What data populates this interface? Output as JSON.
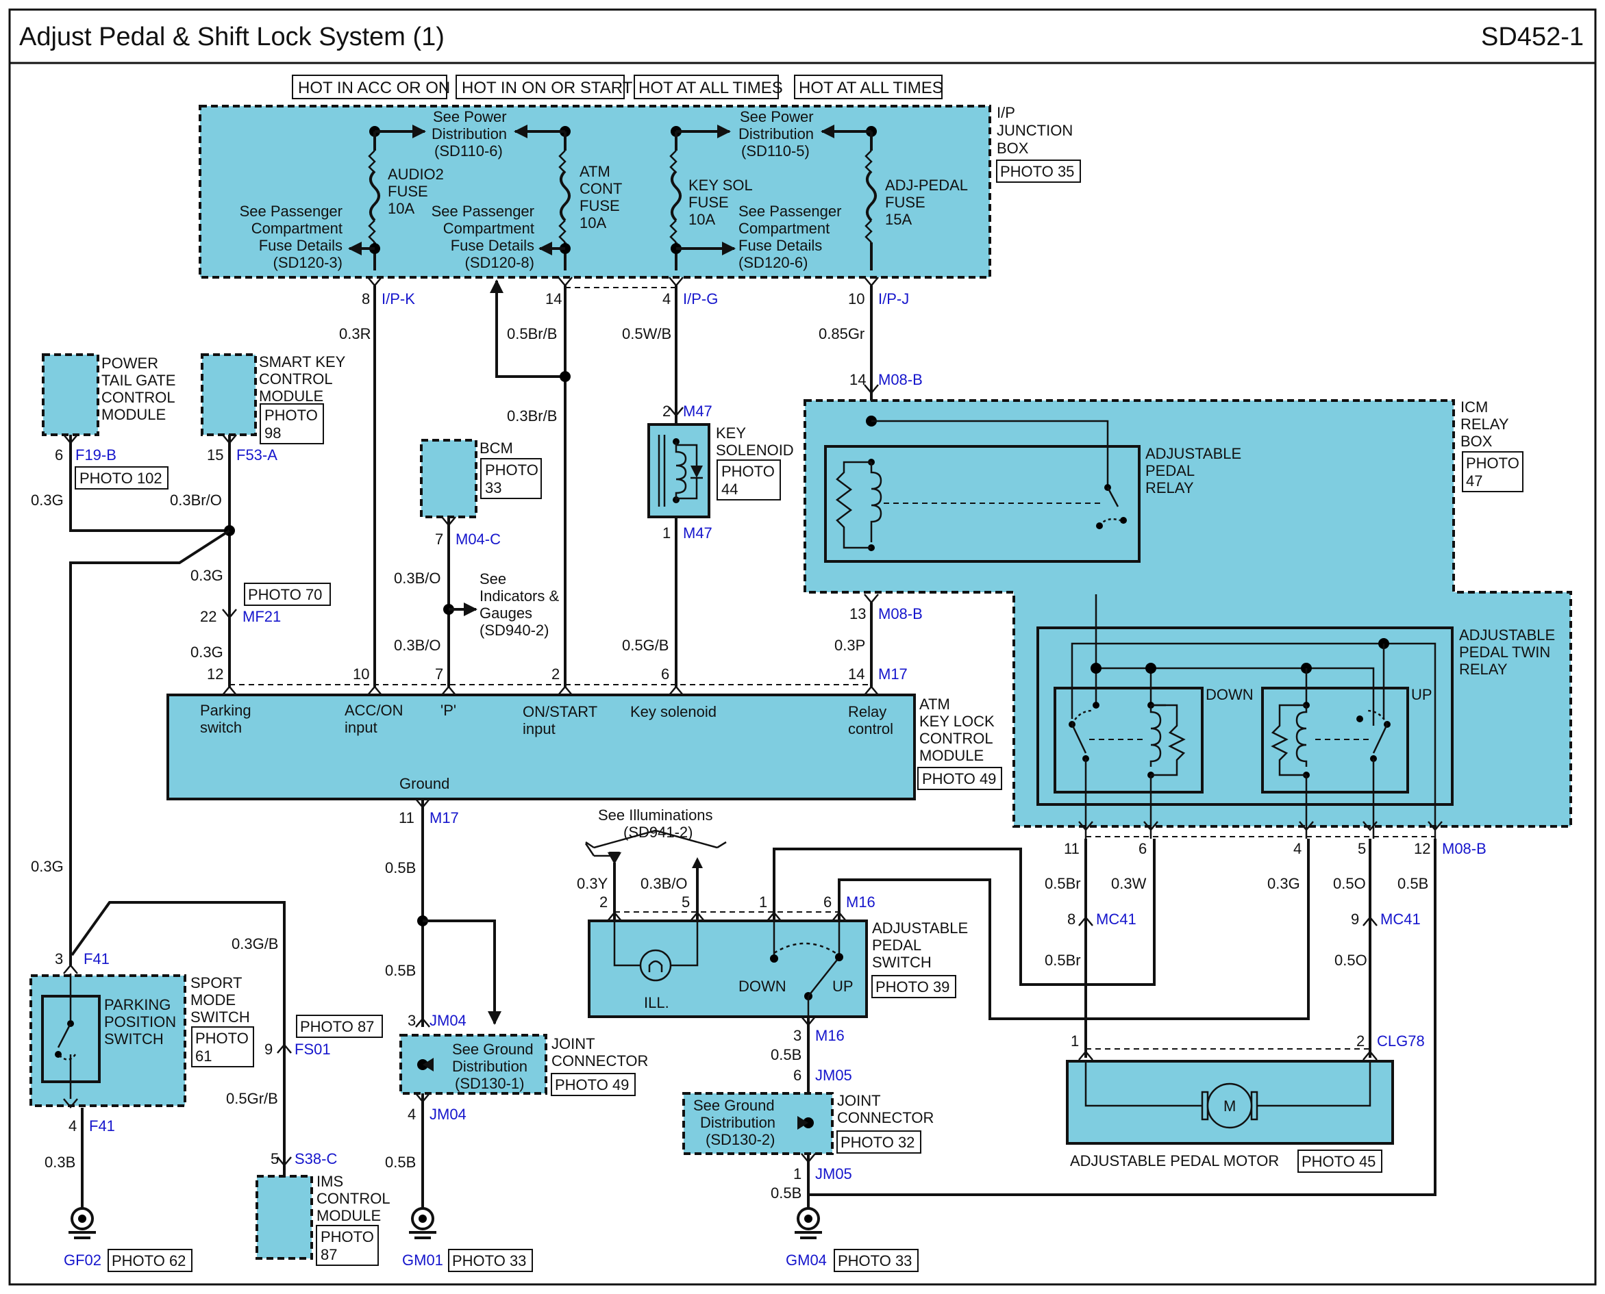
{
  "header": {
    "title": "Adjust Pedal & Shift Lock System (1)",
    "code": "SD452-1"
  },
  "hot": [
    "HOT IN ACC OR ON",
    "HOT IN ON OR START",
    "HOT AT ALL TIMES",
    "HOT AT ALL TIMES"
  ],
  "ipjb": {
    "l1": "I/P",
    "l2": "JUNCTION",
    "l3": "BOX",
    "photo": "PHOTO 35"
  },
  "fuses": {
    "f1": [
      "AUDIO2",
      "FUSE",
      "10A"
    ],
    "f2": [
      "ATM",
      "CONT",
      "FUSE",
      "10A"
    ],
    "f3": [
      "KEY SOL",
      "FUSE",
      "10A"
    ],
    "f4": [
      "ADJ-PEDAL",
      "FUSE",
      "15A"
    ]
  },
  "refs": {
    "pd1": [
      "See Power",
      "Distribution",
      "(SD110-6)"
    ],
    "pd2": [
      "See Power",
      "Distribution",
      "(SD110-5)"
    ],
    "pc1": [
      "See Passenger",
      "Compartment",
      "Fuse Details",
      "(SD120-3)"
    ],
    "pc2": [
      "See Passenger",
      "Compartment",
      "Fuse Details",
      "(SD120-8)"
    ],
    "pc3": [
      "See Passenger",
      "Compartment",
      "Fuse Details",
      "(SD120-6)"
    ],
    "ind": [
      "See",
      "Indicators &",
      "Gauges",
      "(SD940-2)"
    ],
    "ill": [
      "See Illuminations",
      "(SD941-2)"
    ],
    "gd1": [
      "See Ground",
      "Distribution",
      "(SD130-1)"
    ],
    "gd2": [
      "See Ground",
      "Distribution",
      "(SD130-2)"
    ]
  },
  "pins": {
    "p8": "8",
    "ipk": "I/P-K",
    "p14a": "14",
    "p4": "4",
    "ipg": "I/P-G",
    "p10": "10",
    "ipj": "I/P-J",
    "p14b": "14",
    "m08b1": "M08-B",
    "p2": "2",
    "m47a": "M47",
    "p1": "1",
    "m47b": "M47",
    "p6a": "6",
    "f19b": "F19-B",
    "p15": "15",
    "f53a": "F53-A",
    "p7": "7",
    "m04c": "M04-C",
    "p22": "22",
    "mf21": "MF21",
    "p13": "13",
    "m08b2": "M08-B",
    "p14c": "14",
    "m17a": "M17",
    "a12": "12",
    "a10": "10",
    "a7": "7",
    "a2": "2",
    "a6": "6",
    "p11": "11",
    "m17b": "M17",
    "p3a": "3",
    "f41a": "F41",
    "p4b": "4",
    "f41b": "F41",
    "p9": "9",
    "fs01": "FS01",
    "p5": "5",
    "s38c": "S38-C",
    "p3b": "3",
    "jm04a": "JM04",
    "p4c": "4",
    "jm04b": "JM04",
    "s2": "2",
    "s5": "5",
    "s1": "1",
    "s6": "6",
    "m16a": "M16",
    "p3c": "3",
    "m16b": "M16",
    "p6b": "6",
    "jm05a": "JM05",
    "p1b": "1",
    "jm05b": "JM05",
    "r11": "11",
    "r6": "6",
    "r4": "4",
    "r5": "5",
    "r12": "12",
    "m08b3": "M08-B",
    "mc8": "8",
    "mc41a": "MC41",
    "mc9": "9",
    "mc41b": "MC41",
    "m1": "1",
    "m2": "2",
    "clg78": "CLG78",
    "gf02": "GF02",
    "gm01": "GM01",
    "gm04": "GM04"
  },
  "wires": {
    "w1": "0.3R",
    "w2": "0.5Br/B",
    "w3": "0.5W/B",
    "w4": "0.85Gr",
    "w5": "0.3Br/B",
    "w6": "0.3G",
    "w7": "0.3Br/O",
    "w8": "0.3G",
    "w9": "0.3G",
    "w10": "0.3B/O",
    "w11": "0.3B/O",
    "w12": "0.5G/B",
    "w13": "0.3P",
    "w14": "0.3G",
    "w15": "0.3G/B",
    "w16": "0.5Gr/B",
    "w17": "0.3B",
    "w18": "0.5B",
    "w19": "0.5B",
    "w20": "0.5B",
    "w21": "0.3Y",
    "w22": "0.3B/O",
    "w23": "0.5B",
    "w24": "0.5B",
    "w25": "0.5Br",
    "w26": "0.3W",
    "w27": "0.3G",
    "w28": "0.5O",
    "w29": "0.5B",
    "w30": "0.5Br",
    "w31": "0.5O"
  },
  "modules": {
    "ptg": [
      "POWER",
      "TAIL GATE",
      "CONTROL",
      "MODULE"
    ],
    "skm": [
      "SMART KEY",
      "CONTROL",
      "MODULE"
    ],
    "skm_photo": [
      "PHOTO",
      "98"
    ],
    "ptg_photo": "PHOTO 102",
    "bcm": "BCM",
    "bcm_photo": [
      "PHOTO",
      "33"
    ],
    "keysol": [
      "KEY",
      "SOLENOID"
    ],
    "keysol_photo": [
      "PHOTO",
      "44"
    ],
    "photo70": "PHOTO 70",
    "icm": [
      "ICM",
      "RELAY",
      "BOX"
    ],
    "icm_photo": [
      "PHOTO",
      "47"
    ],
    "apr": [
      "ADJUSTABLE",
      "PEDAL",
      "RELAY"
    ],
    "twin": [
      "ADJUSTABLE",
      "PEDAL TWIN",
      "RELAY"
    ],
    "down": "DOWN",
    "up": "UP",
    "atm": [
      "ATM",
      "KEY LOCK",
      "CONTROL",
      "MODULE"
    ],
    "atm_photo": "PHOTO 49",
    "atm_pins": [
      "Parking",
      "switch",
      "ACC/ON",
      "input",
      "'P'",
      "ON/START",
      "input",
      "Key solenoid",
      "Relay",
      "control",
      "Ground"
    ],
    "sport": [
      "SPORT",
      "MODE",
      "SWITCH"
    ],
    "sport_photo": [
      "PHOTO",
      "61"
    ],
    "pps": [
      "PARKING",
      "POSITION",
      "SWITCH"
    ],
    "photo87": "PHOTO 87",
    "ims": [
      "IMS",
      "CONTROL",
      "MODULE"
    ],
    "ims_photo": [
      "PHOTO",
      "87"
    ],
    "jc1": [
      "JOINT",
      "CONNECTOR"
    ],
    "jc1_photo": "PHOTO 49",
    "jc2": [
      "JOINT",
      "CONNECTOR"
    ],
    "jc2_photo": "PHOTO 32",
    "aps": [
      "ADJUSTABLE",
      "PEDAL",
      "SWITCH"
    ],
    "aps_photo": "PHOTO 39",
    "ill": "ILL.",
    "sdown": "DOWN",
    "sup": "UP",
    "motor": "ADJUSTABLE PEDAL MOTOR",
    "motor_photo": "PHOTO 45",
    "m": "M",
    "gf02_photo": "PHOTO 62",
    "gm01_photo": "PHOTO 33",
    "gm04_photo": "PHOTO 33"
  }
}
